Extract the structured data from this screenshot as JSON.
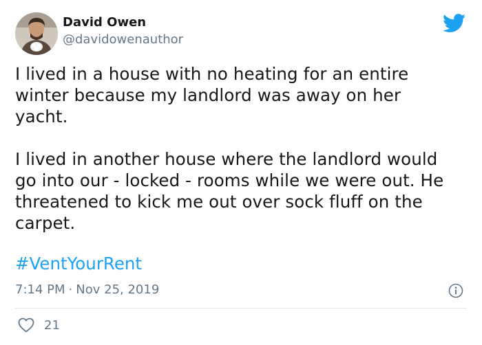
{
  "author": {
    "display_name": "David Owen",
    "handle": "@davidowenauthor"
  },
  "tweet": {
    "paragraphs": [
      "I lived in a house with no heating for an entire\nwinter because my landlord was away on her\nyacht.",
      "I lived in another house where the landlord would\ngo into our - locked - rooms while we were out. He\nthreatened to kick me out over sock fluff on the\ncarpet."
    ],
    "hashtag": "#VentYourRent",
    "time": "7:14 PM",
    "separator": "·",
    "date": "Nov 25, 2019",
    "like_count": "21"
  },
  "icons": {
    "brand": "twitter-bird-icon",
    "info": "info-icon",
    "like": "heart-icon"
  },
  "colors": {
    "twitter_blue": "#1da1f2",
    "secondary_text": "#657786",
    "primary_text": "#14171a",
    "divider": "#e1e8ed"
  }
}
